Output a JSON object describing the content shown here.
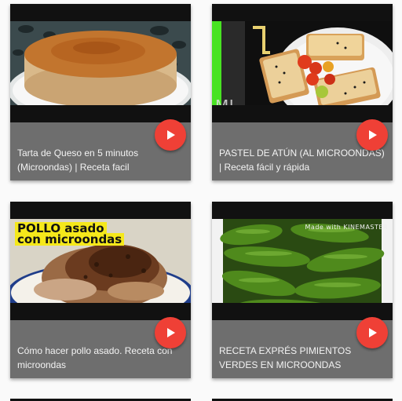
{
  "videos": [
    {
      "title": "Tarta de Queso en 5 minutos (Microondas) | Receta facil",
      "thumb_colors": {
        "bg": "#3b4a4d",
        "main": "#c07a36",
        "plate": "#f5f5f5"
      }
    },
    {
      "title": "PASTEL DE ATÚN (AL MICROONDAS) | Receta fácil y rápida",
      "thumb_colors": {
        "bg": "#0f0f0f",
        "main": "#e8c98a",
        "plate": "#e9e9e9",
        "accent": "#48e322"
      },
      "brand_mark": "MJ"
    },
    {
      "title": "Cómo hacer pollo asado. Receta con microondas",
      "thumb_colors": {
        "bg": "#d9d4c6",
        "main": "#7a4a2a",
        "plate": "#ffffff",
        "caption_bg": "#f5e81b"
      },
      "overlay_caption": [
        "POLLO asado",
        "con microondas"
      ]
    },
    {
      "title": "RECETA EXPRÉS PIMIENTOS VERDES EN MICROONDAS",
      "thumb_colors": {
        "bg": "#2a4a12",
        "main": "#4f8a1c"
      },
      "watermark": "Made with KINEMASTER"
    }
  ],
  "play_button": {
    "icon": "play-icon",
    "color": "#ef4036"
  }
}
